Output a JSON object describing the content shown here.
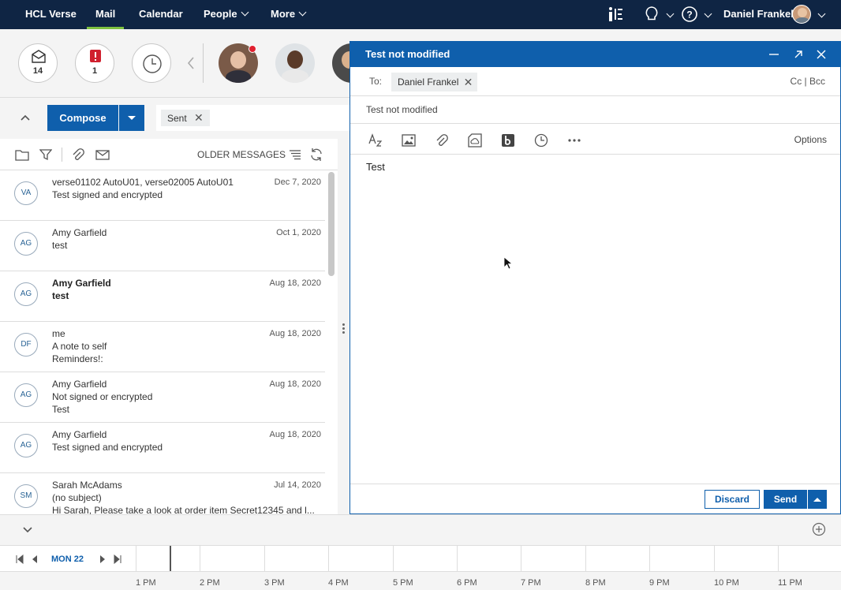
{
  "nav": {
    "brand": "HCL Verse",
    "mail": "Mail",
    "calendar": "Calendar",
    "people": "People",
    "more": "More",
    "user": "Daniel Frankel"
  },
  "bubbles": {
    "inbox_count": "14",
    "important_count": "1"
  },
  "compose_bar": {
    "compose_label": "Compose",
    "filter_chip": "Sent"
  },
  "list_toolbar": {
    "older_messages": "OLDER MESSAGES"
  },
  "messages": [
    {
      "initials": "VA",
      "from": "verse01102 AutoU01, verse02005 AutoU01",
      "subject": "Test signed and encrypted",
      "preview": "",
      "date": "Dec 7, 2020",
      "unread": false
    },
    {
      "initials": "AG",
      "from": "Amy Garfield",
      "subject": "test",
      "preview": "",
      "date": "Oct 1, 2020",
      "unread": false
    },
    {
      "initials": "AG",
      "from": "Amy Garfield",
      "subject": "test",
      "preview": "",
      "date": "Aug 18, 2020",
      "unread": true
    },
    {
      "initials": "DF",
      "from": "me",
      "subject": "A note to self",
      "preview": "Reminders!:",
      "date": "Aug 18, 2020",
      "unread": false
    },
    {
      "initials": "AG",
      "from": "Amy Garfield",
      "subject": "Not signed or encrypted",
      "preview": "Test",
      "date": "Aug 18, 2020",
      "unread": false
    },
    {
      "initials": "AG",
      "from": "Amy Garfield",
      "subject": "Test signed and encrypted",
      "preview": "",
      "date": "Aug 18, 2020",
      "unread": false
    },
    {
      "initials": "SM",
      "from": "Sarah McAdams",
      "subject": "(no subject)",
      "preview": "Hi Sarah, Please take a look at order item Secret12345 and l...",
      "date": "Jul 14, 2020",
      "unread": false
    }
  ],
  "compose_window": {
    "title": "Test not modified",
    "to_label": "To:",
    "recipient": "Daniel Frankel",
    "cc_bcc": "Cc | Bcc",
    "subject": "Test not modified",
    "options_label": "Options",
    "body": "Test",
    "discard_label": "Discard",
    "send_label": "Send"
  },
  "calendar": {
    "day": "MON 22",
    "hours": [
      "1 PM",
      "2 PM",
      "3 PM",
      "4 PM",
      "5 PM",
      "6 PM",
      "7 PM",
      "8 PM",
      "9 PM",
      "10 PM",
      "11 PM"
    ]
  },
  "colors": {
    "nav_bg": "#0f2544",
    "accent_blue": "#0f5fac",
    "active_tab": "#7ec240",
    "important_red": "#d0202e"
  }
}
